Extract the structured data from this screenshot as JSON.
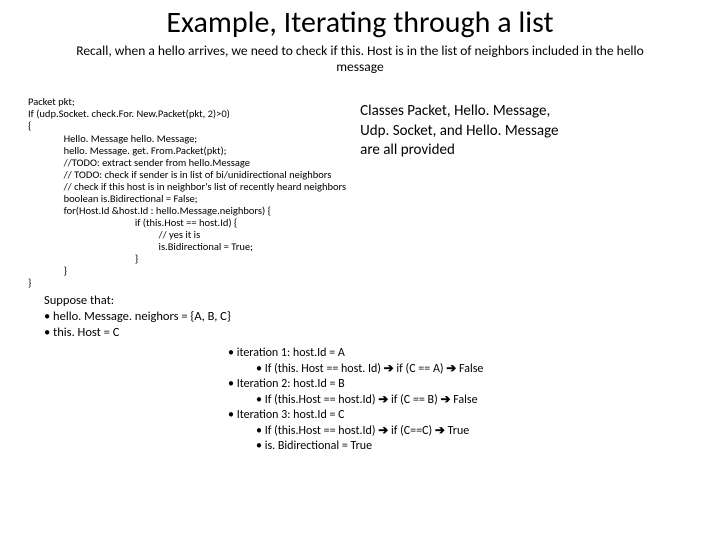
{
  "title": "Example, Iterating through a list",
  "subtitle": "Recall, when a hello arrives, we need to check if this. Host is in the list of neighbors included in the hello message",
  "code": {
    "l1": "Packet pkt;",
    "l2": "If (udp.Socket. check.For. New.Packet(pkt, 2)>0)",
    "l3": "{",
    "l4": "               Hello. Message hello. Message;",
    "l5": "               hello. Message. get. From.Packet(pkt);",
    "l6": "               //TODO: extract sender from hello.Message",
    "l7": "               // TODO: check if sender is in list of bi/unidirectional neighbors",
    "l8": "               // check if this host is in neighbor's list of recently heard neighbors",
    "l9": "               boolean is.Bidirectional = False;",
    "l10": "               for(Host.Id &host.Id : hello.Message.neighbors) {",
    "l11": "                                             if (this.Host == host.Id) {",
    "l12": "                                                       // yes it is",
    "l13": "                                                       is.Bidirectional = True;",
    "l14": "                                             }",
    "l15": "               }",
    "l16": "}"
  },
  "side": {
    "l1": "Classes Packet, Hello. Message,",
    "l2": "Udp. Socket, and Hello. Message",
    "l3": "are all provided"
  },
  "suppose": {
    "head": "Suppose that:",
    "b1": "•   hello. Message. neighors = {A, B, C}",
    "b2": "•   this. Host = C"
  },
  "iter": {
    "i1": "•    iteration 1: host.Id = A",
    "i1a": "•    If (this. Host == host. Id)",
    "i1b": " if (C == A) ",
    "i1c": " False",
    "i2": "•    Iteration 2: host.Id = B",
    "i2a": "•    If (this.Host == host.Id)",
    "i2b": " if (C == B) ",
    "i2c": " False",
    "i3": "•    Iteration 3: host.Id = C",
    "i3a": "•    If (this.Host == host.Id)",
    "i3b": " if (C==C) ",
    "i3c": " True",
    "i3d": "•    is. Bidirectional = True"
  },
  "arrow": "➔"
}
